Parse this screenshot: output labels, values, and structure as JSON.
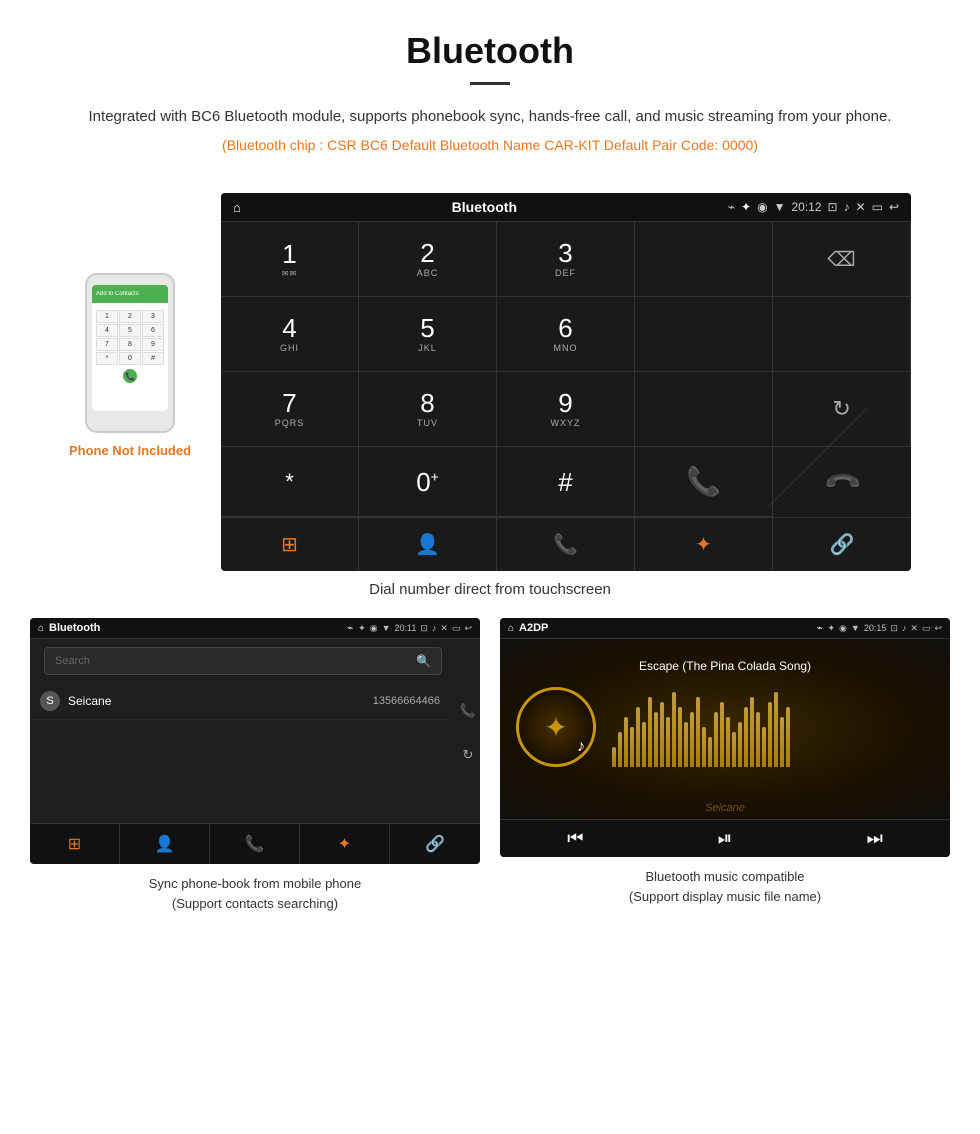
{
  "header": {
    "title": "Bluetooth",
    "description": "Integrated with BC6 Bluetooth module, supports phonebook sync, hands-free call, and music streaming from your phone.",
    "specs": "(Bluetooth chip : CSR BC6    Default Bluetooth Name CAR-KIT    Default Pair Code: 0000)"
  },
  "main_screen": {
    "status_bar": {
      "home_icon": "⌂",
      "title": "Bluetooth",
      "usb_icon": "⌁",
      "bluetooth_icon": "✦",
      "location_icon": "◉",
      "wifi_icon": "▼",
      "time": "20:12",
      "camera_icon": "⊡",
      "volume_icon": "♪",
      "close_icon": "✕",
      "window_icon": "▭",
      "back_icon": "↩"
    },
    "dialpad": [
      {
        "num": "1",
        "sub": "⌂⌂",
        "row": 0,
        "col": 0
      },
      {
        "num": "2",
        "sub": "ABC",
        "row": 0,
        "col": 1
      },
      {
        "num": "3",
        "sub": "DEF",
        "row": 0,
        "col": 2
      },
      {
        "num": "4",
        "sub": "GHI",
        "row": 1,
        "col": 0
      },
      {
        "num": "5",
        "sub": "JKL",
        "row": 1,
        "col": 1
      },
      {
        "num": "6",
        "sub": "MNO",
        "row": 1,
        "col": 2
      },
      {
        "num": "7",
        "sub": "PQRS",
        "row": 2,
        "col": 0
      },
      {
        "num": "8",
        "sub": "TUV",
        "row": 2,
        "col": 1
      },
      {
        "num": "9",
        "sub": "WXYZ",
        "row": 2,
        "col": 2
      },
      {
        "num": "*",
        "sub": "",
        "row": 3,
        "col": 0
      },
      {
        "num": "0+",
        "sub": "",
        "row": 3,
        "col": 1
      },
      {
        "num": "#",
        "sub": "",
        "row": 3,
        "col": 2
      }
    ],
    "bottom_buttons": [
      "⊞",
      "👤",
      "📞",
      "✦",
      "🔗"
    ]
  },
  "main_caption": "Dial number direct from touchscreen",
  "phone_aside": {
    "not_included_label": "Phone Not Included",
    "screen_label": "Add to Contacts",
    "keys": [
      "1",
      "2",
      "3",
      "4",
      "5",
      "6",
      "7",
      "8",
      "9",
      "*",
      "0",
      "#"
    ]
  },
  "phonebook_screen": {
    "status_bar": {
      "home": "⌂",
      "title": "Bluetooth",
      "usb": "⌁",
      "bt": "✦",
      "loc": "◉",
      "wifi": "▼",
      "time": "20:11",
      "camera": "⊡",
      "vol": "♪",
      "x": "✕",
      "win": "▭",
      "back": "↩"
    },
    "search_placeholder": "Search",
    "contacts": [
      {
        "letter": "S",
        "name": "Seicane",
        "number": "13566664466"
      }
    ],
    "bottom_buttons": [
      "⊞",
      "👤",
      "📞",
      "✦",
      "🔗"
    ]
  },
  "phonebook_caption": {
    "line1": "Sync phone-book from mobile phone",
    "line2": "(Support contacts searching)"
  },
  "music_screen": {
    "status_bar": {
      "home": "⌂",
      "title": "A2DP",
      "usb": "⌁",
      "bt": "✦",
      "loc": "◉",
      "wifi": "▼",
      "time": "20:15",
      "camera": "⊡",
      "vol": "♪",
      "x": "✕",
      "win": "▭",
      "back": "↩"
    },
    "song_title": "Escape (The Pina Colada Song)",
    "eq_bars": [
      20,
      35,
      50,
      40,
      60,
      45,
      70,
      55,
      65,
      50,
      75,
      60,
      45,
      55,
      70,
      40,
      30,
      55,
      65,
      50,
      35,
      45,
      60,
      70,
      55,
      40,
      65,
      75,
      50,
      60
    ],
    "controls": [
      "⏮",
      "⏭",
      "⏭"
    ]
  },
  "music_caption": {
    "line1": "Bluetooth music compatible",
    "line2": "(Support display music file name)"
  },
  "watermark": "Seicane"
}
